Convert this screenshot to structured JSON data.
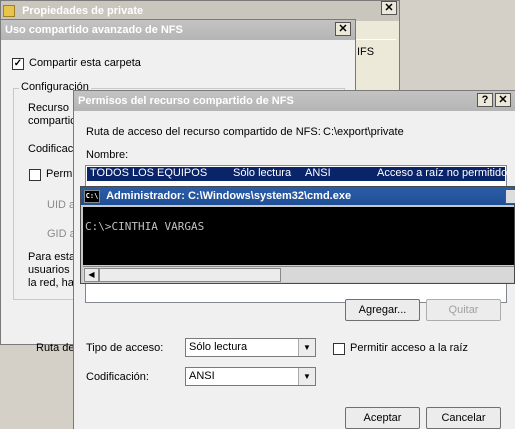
{
  "window_private": {
    "title": "Propiedades de private",
    "close": "✕",
    "tab_label": "IFS"
  },
  "window_nfs": {
    "title": "Uso compartido avanzado de NFS",
    "close": "✕",
    "share_checkbox_label": "Compartir esta carpeta",
    "group_label": "Configuración",
    "resource_label_partial": "Recurso\ncompartic",
    "encoding_label_partial": "Codificac",
    "permit_label_partial": "Permi",
    "uid_partial": "UID a",
    "gid_partial": "GID a",
    "para_partial": "Para esta\nusuarios\nla red, ha",
    "ruta_partial": "Ruta de"
  },
  "window_perms": {
    "title": "Permisos del recurso compartido de NFS",
    "help": "?",
    "close": "✕",
    "path_label": "Ruta de acceso del recurso compartido de NFS:",
    "path_value": "C:\\export\\private",
    "name_label": "Nombre:",
    "row": {
      "name": "TODOS LOS EQUIPOS",
      "access": "Sólo lectura",
      "encoding": "ANSI",
      "root": "Acceso a raíz no permitido"
    },
    "add_button": "Agregar...",
    "remove_button": "Quitar",
    "access_type_label": "Tipo de acceso:",
    "access_type_value": "Sólo lectura",
    "allow_root_label": "Permitir acceso a la raíz",
    "encoding_label": "Codificación:",
    "encoding_value": "ANSI",
    "ok_button": "Aceptar",
    "cancel_button": "Cancelar"
  },
  "cmd": {
    "icon_text": "C:\\",
    "title": "Administrador: C:\\Windows\\system32\\cmd.exe",
    "line": "C:\\>CINTHIA VARGAS"
  },
  "colors": {
    "titlebar_blue": "#1f4e96",
    "selection": "#0a246a",
    "console_bg": "#000000",
    "console_fg": "#c0c0c0"
  }
}
